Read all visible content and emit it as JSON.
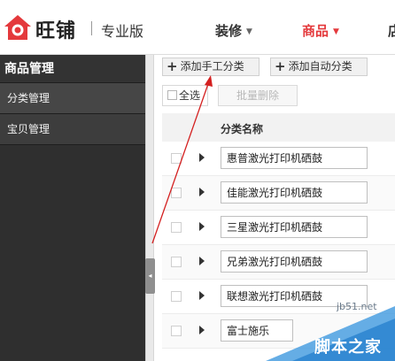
{
  "brand": {
    "name": "旺铺",
    "edition": "专业版"
  },
  "nav": {
    "items": [
      {
        "label": "装修",
        "caret": "▼"
      },
      {
        "label": "商品",
        "caret": "▼"
      },
      {
        "label": "店"
      }
    ]
  },
  "sidebar": {
    "title": "商品管理",
    "items": [
      {
        "label": "分类管理"
      },
      {
        "label": "宝贝管理"
      }
    ]
  },
  "collapse_handle": {
    "glyph": "◂"
  },
  "toolbar": {
    "add_manual_label": "添加手工分类",
    "add_auto_label": "添加自动分类",
    "plus_glyph": "+",
    "select_all_label": "全选",
    "batch_delete_label": "批量删除"
  },
  "table": {
    "column_name_header": "分类名称",
    "rows": [
      {
        "name": "惠普激光打印机硒鼓"
      },
      {
        "name": "佳能激光打印机硒鼓"
      },
      {
        "name": "三星激光打印机硒鼓"
      },
      {
        "name": "兄弟激光打印机硒鼓"
      },
      {
        "name": "联想激光打印机硒鼓"
      },
      {
        "name": "富士施乐"
      }
    ]
  },
  "watermark": {
    "url": "jb51.net",
    "text": "脚本之家"
  },
  "colors": {
    "accent_red": "#e4393c",
    "sidebar_bg": "#2f2f2f",
    "annotation_red": "#d42020"
  },
  "icons": {
    "logo": "house-logo-icon",
    "expand": "triangle-right-icon",
    "add": "plus-icon"
  }
}
